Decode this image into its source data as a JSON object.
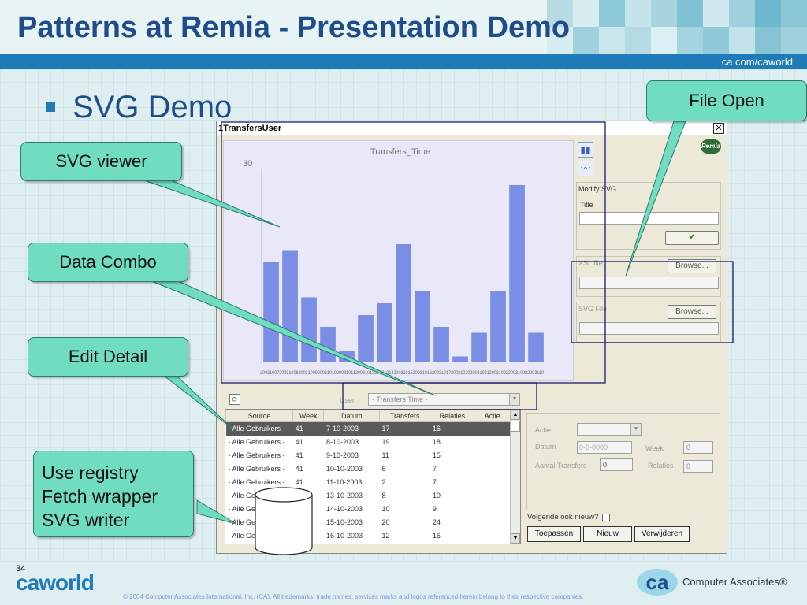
{
  "slide": {
    "title": "Patterns at Remia - Presentation Demo",
    "subtitle": "SVG Demo",
    "header_url": "ca.com/caworld",
    "page_number": "34",
    "footer_logo_left": "caworld",
    "footer_copyright": "© 2004 Computer Associates International, Inc. (CA). All trademarks, trade names, services marks and logos referenced herein belong to their respective companies.",
    "footer_logo_right": "Computer Associates®"
  },
  "callouts": {
    "file_open": "File Open",
    "svg_viewer": "SVG viewer",
    "data_combo": "Data Combo",
    "edit_detail": "Edit Detail",
    "registry": [
      "Use registry",
      "Fetch wrapper",
      "SVG writer"
    ]
  },
  "window": {
    "title": "1TransfersUser",
    "close_glyph": "✕",
    "logo": "Remia"
  },
  "right_panel": {
    "modify_label": "Modify SVG",
    "title_label": "Title",
    "ok_glyph": "✔",
    "xsl_label": "XSL file",
    "svg_label": "SVG File",
    "browse_label": "Browse..."
  },
  "filter": {
    "user_label": "User",
    "combo_value": "- Transfers Time -"
  },
  "table": {
    "columns": [
      "Source",
      "Week",
      "Datum",
      "Transfers",
      "Relaties",
      "Actie"
    ],
    "rows": [
      [
        "- Alle Gebruikers -",
        "41",
        "7-10-2003",
        "17",
        "16",
        ""
      ],
      [
        "- Alle Gebruikers -",
        "41",
        "8-10-2003",
        "19",
        "18",
        ""
      ],
      [
        "- Alle Gebruikers -",
        "41",
        "9-10-2003",
        "11",
        "15",
        ""
      ],
      [
        "- Alle Gebruikers -",
        "41",
        "10-10-2003",
        "6",
        "7",
        ""
      ],
      [
        "- Alle Gebruikers -",
        "41",
        "11-10-2003",
        "2",
        "7",
        ""
      ],
      [
        "- Alle Gebruikers -",
        "42",
        "13-10-2003",
        "8",
        "10",
        ""
      ],
      [
        "- Alle Gebruikers -",
        "42",
        "14-10-2003",
        "10",
        "9",
        ""
      ],
      [
        "- Alle Gebruikers -",
        "42",
        "15-10-2003",
        "20",
        "24",
        ""
      ],
      [
        "- Alle Gebruikers -",
        "42",
        "16-10-2003",
        "12",
        "16",
        ""
      ]
    ]
  },
  "detail": {
    "actie_label": "Actie",
    "datum_label": "Datum",
    "datum_value": "0-0-0000",
    "week_label": "Week",
    "week_value": "0",
    "aantal_label": "Aantal Transfers",
    "aantal_value": "0",
    "relaties_label": "Relaties",
    "relaties_value": "0",
    "volgende_label": "Volgende ook nieuw?"
  },
  "actions": {
    "apply": "Toepassen",
    "new": "Nieuw",
    "delete": "Verwijderen"
  },
  "chart_data": {
    "type": "bar",
    "title": "Transfers_Time",
    "ytick": "30",
    "values": [
      17,
      19,
      11,
      6,
      2,
      8,
      10,
      20,
      12,
      6,
      1,
      5,
      12,
      30,
      5
    ],
    "ymax": 30,
    "categories_text": "20031007200310082003100920031010200310112003101320031014200310152003101620031017200310202003102120031022200310282003110",
    "bar_color": "#7b8ee6"
  }
}
